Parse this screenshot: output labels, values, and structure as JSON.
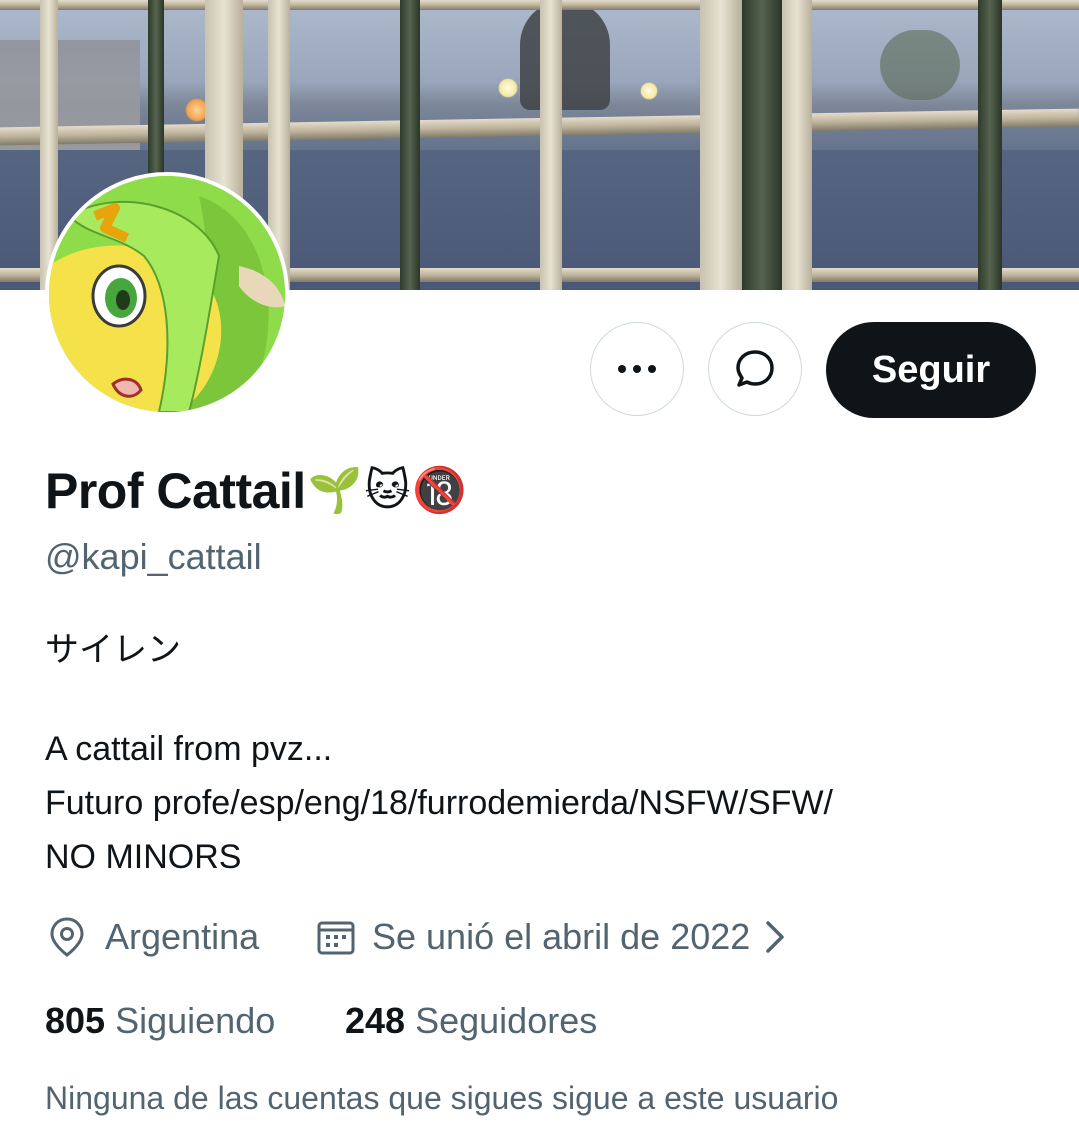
{
  "profile": {
    "display_name": "Prof Cattail",
    "name_emojis": [
      "🌱",
      "🐱",
      "🔞"
    ],
    "handle": "@kapi_cattail",
    "bio_lines": [
      "サイレン",
      "A cattail from pvz...",
      "Futuro profe/esp/eng/18/furrodemierda/NSFW/SFW/",
      "NO MINORS"
    ],
    "location": "Argentina",
    "joined": "Se unió el abril de 2022",
    "following_count": "805",
    "following_label": "Siguiendo",
    "followers_count": "248",
    "followers_label": "Seguidores",
    "followed_by_note": "Ninguna de las cuentas que sigues sigue a este usuario"
  },
  "actions": {
    "follow_label": "Seguir"
  },
  "icons": {
    "more": "more-dots-icon",
    "message": "message-bubble-icon",
    "location": "location-pin-icon",
    "calendar": "calendar-icon",
    "chevron": "chevron-right-icon"
  },
  "colors": {
    "text_primary": "#0f1419",
    "text_secondary": "#536471",
    "follow_button_bg": "#0f1419",
    "border": "#cfd9de"
  }
}
